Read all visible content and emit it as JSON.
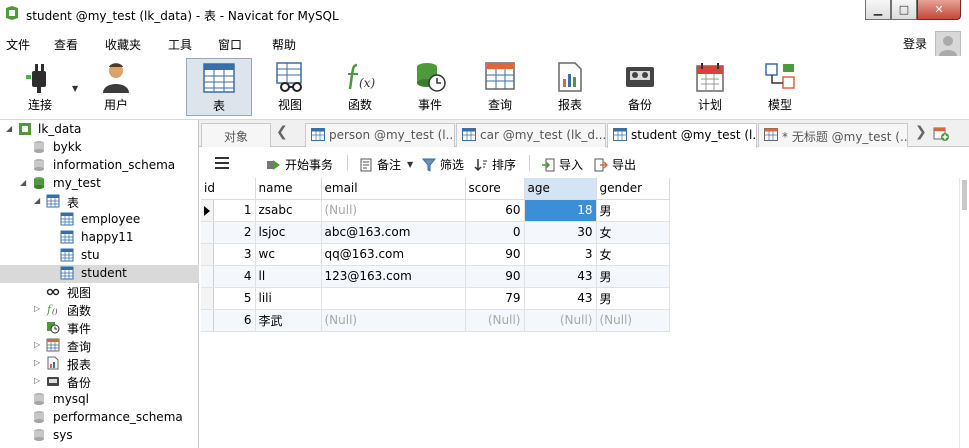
{
  "window": {
    "title": "student @my_test (lk_data) - 表 - Navicat for MySQL",
    "min_label": "▁",
    "max_label": "□",
    "close_label": "✕"
  },
  "menu": {
    "items": [
      "文件",
      "查看",
      "收藏夹",
      "工具",
      "窗口",
      "帮助"
    ],
    "login": "登录"
  },
  "toolbar": {
    "items": [
      {
        "label": "连接",
        "icon": "plug-icon"
      },
      {
        "label": "用户",
        "icon": "user-icon"
      },
      {
        "label": "表",
        "icon": "table-icon",
        "active": true
      },
      {
        "label": "视图",
        "icon": "view-icon"
      },
      {
        "label": "函数",
        "icon": "function-icon"
      },
      {
        "label": "事件",
        "icon": "event-icon"
      },
      {
        "label": "查询",
        "icon": "query-icon"
      },
      {
        "label": "报表",
        "icon": "report-icon"
      },
      {
        "label": "备份",
        "icon": "backup-icon"
      },
      {
        "label": "计划",
        "icon": "schedule-icon"
      },
      {
        "label": "模型",
        "icon": "model-icon"
      }
    ]
  },
  "navigator": {
    "items": [
      {
        "label": "lk_data",
        "icon": "connection-icon",
        "expanded": true
      },
      {
        "label": "bykk",
        "icon": "database-icon"
      },
      {
        "label": "information_schema",
        "icon": "database-icon"
      },
      {
        "label": "my_test",
        "icon": "database-icon",
        "expanded": true
      },
      {
        "label": "表",
        "icon": "tables-folder-icon",
        "expanded": true
      },
      {
        "label": "employee",
        "icon": "table-icon"
      },
      {
        "label": "happy11",
        "icon": "table-icon"
      },
      {
        "label": "stu",
        "icon": "table-icon"
      },
      {
        "label": "student",
        "icon": "table-icon",
        "selected": true
      },
      {
        "label": "视图",
        "icon": "view-icon"
      },
      {
        "label": "函数",
        "icon": "function-icon"
      },
      {
        "label": "事件",
        "icon": "event-icon"
      },
      {
        "label": "查询",
        "icon": "query-icon"
      },
      {
        "label": "报表",
        "icon": "report-icon"
      },
      {
        "label": "备份",
        "icon": "backup-icon"
      },
      {
        "label": "mysql",
        "icon": "database-icon"
      },
      {
        "label": "performance_schema",
        "icon": "database-icon"
      },
      {
        "label": "sys",
        "icon": "database-icon"
      }
    ]
  },
  "tabs": {
    "objects": "对象",
    "items": [
      {
        "label": "person @my_test (l..."
      },
      {
        "label": "car @my_test (lk_d..."
      },
      {
        "label": "student @my_test (l...",
        "active": true
      },
      {
        "label": "* 无标题 @my_test (..."
      }
    ]
  },
  "data_toolbar": {
    "begin_transaction": "开始事务",
    "memo": "备注",
    "filter": "筛选",
    "sort": "排序",
    "import": "导入",
    "export": "导出"
  },
  "grid": {
    "columns": [
      "id",
      "name",
      "email",
      "score",
      "age",
      "gender"
    ],
    "sorted_column": "age",
    "selected_cell": {
      "row": 0,
      "column": "age"
    },
    "rows": [
      {
        "id": "1",
        "name": "zsabc",
        "email": "(Null)",
        "score": "60",
        "age": "18",
        "gender": "男"
      },
      {
        "id": "2",
        "name": "lsjoc",
        "email": "abc@163.com",
        "score": "0",
        "age": "30",
        "gender": "女"
      },
      {
        "id": "3",
        "name": "wc",
        "email": "qq@163.com",
        "score": "90",
        "age": "3",
        "gender": "女"
      },
      {
        "id": "4",
        "name": "ll",
        "email": "123@163.com",
        "score": "90",
        "age": "43",
        "gender": "男"
      },
      {
        "id": "5",
        "name": "lili",
        "email": "",
        "score": "79",
        "age": "43",
        "gender": "男"
      },
      {
        "id": "6",
        "name": "李武",
        "email": "(Null)",
        "score": "(Null)",
        "age": "(Null)",
        "gender": "(Null)"
      }
    ]
  },
  "colors": {
    "selected_cell": "#3b8fd8",
    "null_text": "#a8a8a8",
    "active_tool_bg": "#dde4ec"
  }
}
